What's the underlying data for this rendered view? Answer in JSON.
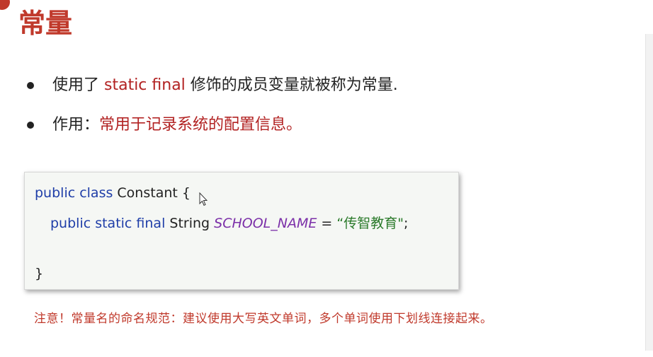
{
  "slide": {
    "title": "常量",
    "bullets": [
      {
        "prefix": "使用了 ",
        "highlight": "static final",
        "suffix": " 修饰的成员变量就被称为常量."
      },
      {
        "prefix": "作用：",
        "highlight": "常用于记录系统的配置信息。",
        "suffix": ""
      }
    ],
    "code": {
      "line1": {
        "kw": "public class",
        "name": " Constant {"
      },
      "line2": {
        "kw": "public static final",
        "type": " String ",
        "const": "SCHOOL_NAME",
        "eq": "  =  ",
        "str": "“传智教育\"",
        "end": ";"
      },
      "line3": "}"
    },
    "note": "注意！常量名的命名规范：建议使用大写英文单词，多个单词使用下划线连接起来。"
  },
  "colors": {
    "accent": "#c0392b",
    "keyword": "#1f3ea8",
    "constant": "#7b2fa8",
    "string": "#2a7a2a"
  },
  "icons": [
    "mouse-pointer-icon",
    "bullet-dot-icon"
  ]
}
